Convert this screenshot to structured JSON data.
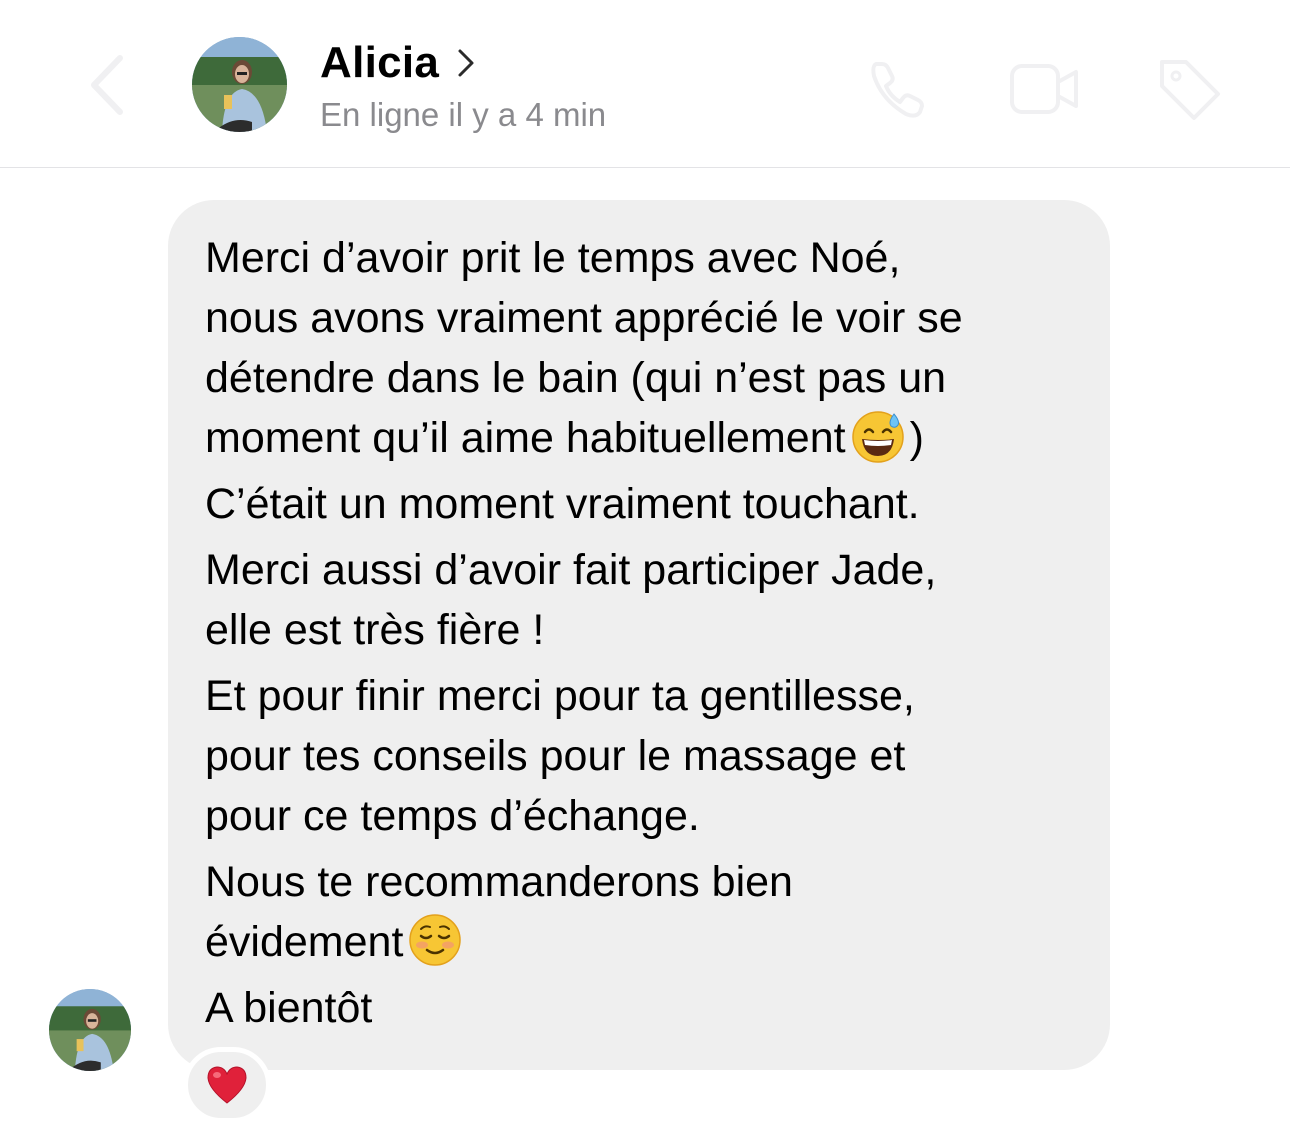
{
  "header": {
    "contact_name": "Alicia",
    "status": "En ligne il y a 4 min",
    "icons": [
      "back-chevron-icon",
      "chevron-right-icon",
      "phone-icon",
      "video-camera-icon",
      "tag-icon"
    ]
  },
  "message": {
    "lines": [
      "Merci d’avoir prit le temps avec Noé,",
      "nous avons vraiment apprécié le voir se",
      "détendre dans le bain (qui n’est pas un",
      "moment qu’il aime habituellement",
      "C’était un moment vraiment touchant.",
      "Merci aussi d’avoir fait participer Jade,",
      "elle est très fière !",
      "Et pour finir merci pour ta gentillesse,",
      "pour tes conseils pour le massage et",
      "pour ce temps d’échange.",
      "Nous te recommanderons bien",
      "évidement",
      "A bientôt"
    ],
    "line4_suffix": ")",
    "emojis": [
      "grinning-sweat-emoji",
      "smiling-blush-emoji"
    ],
    "reaction": "heart-emoji"
  },
  "colors": {
    "bubble": "#efefef",
    "status_text": "#8a8a8e",
    "divider": "#e3e3e6",
    "heart": "#e0213a"
  }
}
